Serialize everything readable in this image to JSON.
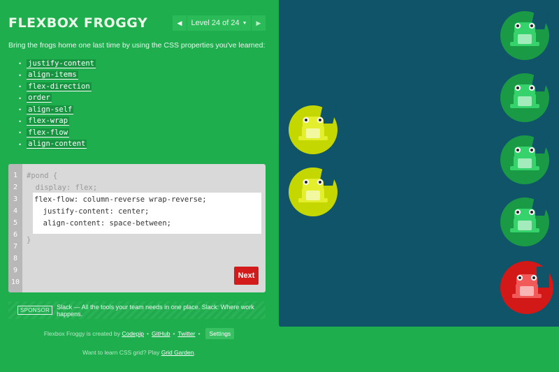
{
  "header": {
    "title": "FLEXBOX FROGGY",
    "level_label": "Level 24 of 24",
    "prev_icon": "triangle-left-icon",
    "next_icon": "triangle-right-icon",
    "dropdown_icon": "caret-down-icon"
  },
  "instructions": "Bring the frogs home one last time by using the CSS properties you've learned:",
  "properties": [
    "justify-content",
    "align-items",
    "flex-direction",
    "order",
    "align-self",
    "flex-wrap",
    "flex-flow",
    "align-content"
  ],
  "editor": {
    "line_numbers": [
      "1",
      "2",
      "3",
      "4",
      "5",
      "6",
      "7",
      "8",
      "9",
      "10"
    ],
    "line1": "#pond {",
    "line2": "  display: flex;",
    "answer": [
      "flex-flow: column-reverse wrap-reverse;",
      "  justify-content: center;",
      "  align-content: space-between;"
    ],
    "line6": "}",
    "next_label": "Next"
  },
  "sponsor": {
    "tag": "SPONSOR",
    "text": "Slack — All the tools your team needs in one place. Slack: Where work happens."
  },
  "footer": {
    "created_by": "Flexbox Froggy is created by ",
    "codepip": "Codepip",
    "github": "GitHub",
    "twitter": "Twitter",
    "settings": "Settings",
    "grid_prefix": "Want to learn CSS grid? Play ",
    "grid_link": "Grid Garden",
    "grid_suffix": "."
  },
  "colors": {
    "background": "#1fae4e",
    "pond": "#0f5468",
    "next_button": "#d41b1b",
    "green_pad": "#1a9a45",
    "green_frog": "#36d36c",
    "yellow_pad": "#c4d800",
    "yellow_frog": "#e3ef2c",
    "red_pad": "#d31818",
    "red_frog": "#f25a5a"
  },
  "frogs": [
    {
      "color": "green",
      "icon": "frog-icon"
    },
    {
      "color": "green",
      "icon": "frog-icon"
    },
    {
      "color": "green",
      "icon": "frog-icon"
    },
    {
      "color": "green",
      "icon": "frog-icon"
    },
    {
      "color": "red",
      "icon": "frog-icon"
    },
    {
      "color": "yellow",
      "icon": "frog-icon"
    },
    {
      "color": "yellow",
      "icon": "frog-icon"
    }
  ]
}
